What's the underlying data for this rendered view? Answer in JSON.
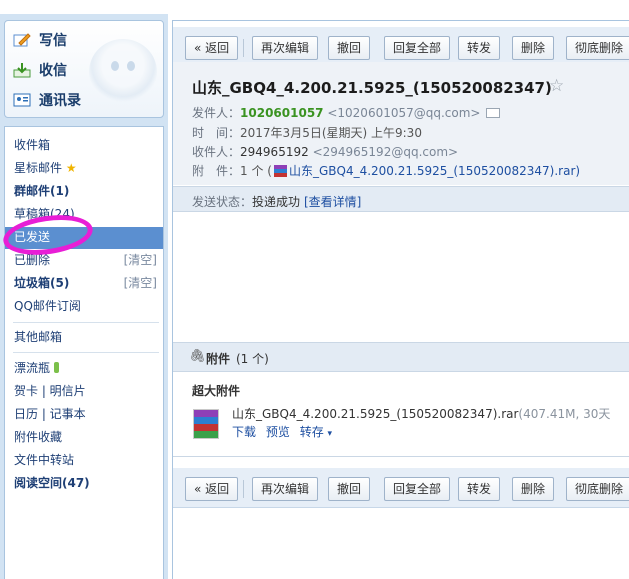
{
  "sidebar": {
    "compose": [
      {
        "label": "写信"
      },
      {
        "label": "收信"
      },
      {
        "label": "通讯录"
      }
    ],
    "folders": {
      "inbox": "收件箱",
      "starred": "星标邮件",
      "group": "群邮件(1)",
      "drafts": "草稿箱(24)",
      "sent": "已发送",
      "deleted": "已删除",
      "deleted_clear": "[清空]",
      "trash": "垃圾箱(5)",
      "trash_clear": "[清空]",
      "qq_subscription": "QQ邮件订阅",
      "other_mailbox": "其他邮箱",
      "drift_bottle": "漂流瓶",
      "card": "贺卡 | 明信片",
      "calendar": "日历 | 记事本",
      "attachment_fav": "附件收藏",
      "file_transfer": "文件中转站",
      "reading_space": "阅读空间(47)"
    }
  },
  "toolbar": {
    "back": "« 返回",
    "reedit": "再次编辑",
    "recall": "撤回",
    "reply_all": "回复全部",
    "forward": "转发",
    "delete": "删除",
    "perm_delete": "彻底删除"
  },
  "mail": {
    "subject": "山东_GBQ4_4.200.21.5925_(150520082347)",
    "star": "☆",
    "from_label": "发件人：",
    "from_name": "1020601057",
    "from_addr": "<1020601057@qq.com>",
    "time_label": "时　间：",
    "time_value": "2017年3月5日(星期天) 上午9:30",
    "to_label": "收件人：",
    "to_name": "294965192",
    "to_addr": "<294965192@qq.com>",
    "att_label": "附　件：",
    "att_value_prefix": "1 个 (",
    "att_value_name": "山东_GBQ4_4.200.21.5925_(150520082347).rar)",
    "status_label": "发送状态：",
    "status_value": "投递成功",
    "status_link": "[查看详情]"
  },
  "attachments": {
    "title": "附件",
    "count": "(1 个)",
    "section": "超大附件",
    "file_name": "山东_GBQ4_4.200.21.5925_(150520082347).rar",
    "file_meta": "(407.41M, 30天",
    "download": "下载",
    "preview": "预览",
    "save": "转存"
  },
  "colors": {
    "accent": "#5b8fd0",
    "annotation": "#e81ed6",
    "sender_green": "#3a9321"
  }
}
